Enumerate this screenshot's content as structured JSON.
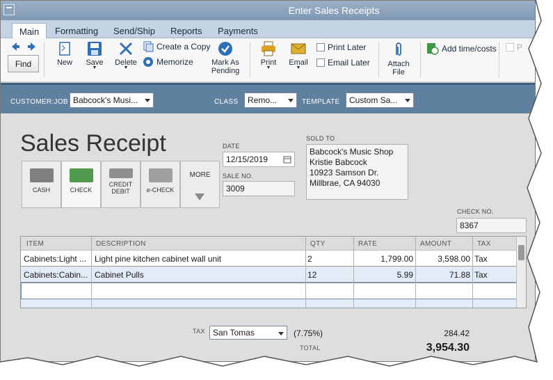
{
  "window": {
    "title": "Enter Sales Receipts"
  },
  "tabs": [
    {
      "label": "Main"
    },
    {
      "label": "Formatting"
    },
    {
      "label": "Send/Ship"
    },
    {
      "label": "Reports"
    },
    {
      "label": "Payments"
    }
  ],
  "ribbon": {
    "find": "Find",
    "new": "New",
    "save": "Save",
    "delete": "Delete",
    "create_copy": "Create a Copy",
    "memorize": "Memorize",
    "mark_as_pending_line1": "Mark As",
    "mark_as_pending_line2": "Pending",
    "print": "Print",
    "email": "Email",
    "print_later": "Print Later",
    "email_later": "Email Later",
    "attach_line1": "Attach",
    "attach_line2": "File",
    "add_time_costs": "Add time/costs",
    "cut_off_label": "P"
  },
  "header": {
    "customer_job_label": "CUSTOMER:JOB",
    "customer_job_value": "Babcock's Musi...",
    "class_label": "CLASS",
    "class_value": "Remo...",
    "template_label": "TEMPLATE",
    "template_value": "Custom Sa..."
  },
  "form": {
    "title": "Sales Receipt",
    "date_label": "DATE",
    "date_value": "12/15/2019",
    "sale_no_label": "SALE NO.",
    "sale_no_value": "3009",
    "sold_to_label": "SOLD TO",
    "sold_to_lines": [
      "Babcock's Music Shop",
      "Kristie Babcock",
      "10923 Samson Dr.",
      "Millbrae, CA 94030"
    ],
    "check_no_label": "CHECK NO.",
    "check_no_value": "8367",
    "payment_methods": [
      {
        "label": "CASH"
      },
      {
        "label": "CHECK"
      },
      {
        "label_line1": "CREDIT",
        "label_line2": "DEBIT"
      },
      {
        "label": "e-CHECK"
      }
    ],
    "more_label": "MORE"
  },
  "table": {
    "columns": [
      "ITEM",
      "DESCRIPTION",
      "QTY",
      "RATE",
      "AMOUNT",
      "TAX"
    ],
    "rows": [
      {
        "item": "Cabinets:Light ...",
        "description": "Light pine kitchen cabinet wall unit",
        "qty": "2",
        "rate": "1,799.00",
        "amount": "3,598.00",
        "tax": "Tax"
      },
      {
        "item": "Cabinets:Cabin...",
        "description": "Cabinet Pulls",
        "qty": "12",
        "rate": "5.99",
        "amount": "71.88",
        "tax": "Tax"
      }
    ]
  },
  "totals": {
    "tax_label": "TAX",
    "tax_item": "San Tomas",
    "tax_rate": "(7.75%)",
    "tax_amount": "284.42",
    "total_label": "TOTAL",
    "total_amount": "3,954.30"
  },
  "colors": {
    "accent_bar": "#6080a0",
    "tab_strip": "#c4d4e4"
  }
}
